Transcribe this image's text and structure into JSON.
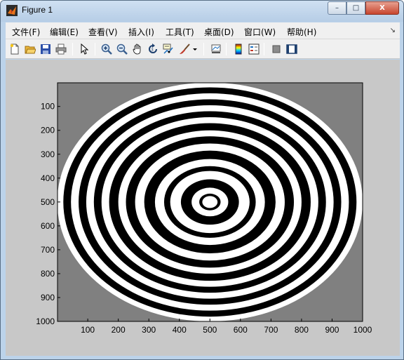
{
  "window": {
    "title": "Figure 1",
    "controls": {
      "minimize": "–",
      "maximize": "□",
      "close": "X"
    }
  },
  "menu": {
    "items": [
      "文件(F)",
      "编辑(E)",
      "查看(V)",
      "插入(I)",
      "工具(T)",
      "桌面(D)",
      "窗口(W)",
      "帮助(H)"
    ]
  },
  "toolbar": {
    "icons": [
      "new-figure-icon",
      "open-file-icon",
      "save-icon",
      "print-icon",
      "pointer-icon",
      "zoom-in-icon",
      "zoom-out-icon",
      "pan-icon",
      "rotate-3d-icon",
      "data-cursor-icon",
      "brush-icon",
      "brush-dropdown-icon",
      "link-plot-icon",
      "colorbar-icon",
      "legend-icon",
      "hide-plot-tools-icon",
      "show-plot-tools-icon"
    ]
  },
  "axes": {
    "x_ticks": [
      "100",
      "200",
      "300",
      "400",
      "500",
      "600",
      "700",
      "800",
      "900",
      "1000"
    ],
    "y_ticks": [
      "100",
      "200",
      "300",
      "400",
      "500",
      "600",
      "700",
      "800",
      "900",
      "1000"
    ],
    "xlim": [
      1,
      1000
    ],
    "ylim": [
      1,
      1000
    ]
  },
  "chart_data": {
    "type": "heatmap",
    "colormap": "gray",
    "background_value": "gray",
    "pattern": "concentric binary rings",
    "center": [
      500,
      500
    ],
    "outer_radius": 500,
    "rings_from_outside": [
      "white",
      "black",
      "white",
      "black",
      "white",
      "black",
      "white",
      "black",
      "white",
      "black",
      "white",
      "black",
      "white",
      "black",
      "white",
      "black",
      "white",
      "black",
      "white"
    ],
    "ring_radii": [
      500,
      480,
      455,
      430,
      405,
      380,
      355,
      330,
      300,
      275,
      245,
      215,
      180,
      150,
      130,
      95,
      60,
      35,
      25
    ],
    "x_range": [
      1,
      1000
    ],
    "y_range": [
      1,
      1000
    ],
    "colors": {
      "white": "#ffffff",
      "black": "#000000",
      "gray": "#808080"
    }
  }
}
